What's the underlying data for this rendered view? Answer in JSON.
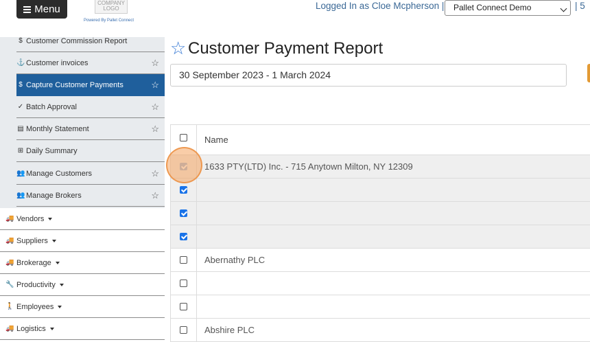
{
  "header": {
    "menu_label": "Menu",
    "logo_text": "COMPANY LOGO",
    "powered_by": "Powered By Pallet Connect",
    "logged_in": "Logged In as Cloe Mcpherson |",
    "company_selected": "Pallet Connect Demo",
    "extra_text": "| 5"
  },
  "sidebar": {
    "sub_items": [
      {
        "icon": "$",
        "label": "Customer Commission Report",
        "star": false,
        "active": false
      },
      {
        "icon": "⚓",
        "label": "Customer invoices",
        "star": true,
        "active": false
      },
      {
        "icon": "$",
        "label": "Capture Customer Payments",
        "star": true,
        "active": true
      },
      {
        "icon": "✓",
        "label": "Batch Approval",
        "star": true,
        "active": false
      },
      {
        "icon": "▤",
        "label": "Monthly Statement",
        "star": true,
        "active": false
      },
      {
        "icon": "⊞",
        "label": "Daily Summary",
        "star": false,
        "active": false
      },
      {
        "icon": "👥",
        "label": "Manage Customers",
        "star": true,
        "active": false
      },
      {
        "icon": "👥",
        "label": "Manage Brokers",
        "star": true,
        "active": false
      }
    ],
    "main_items": [
      {
        "icon": "🚚",
        "label": "Vendors"
      },
      {
        "icon": "🚚",
        "label": "Suppliers"
      },
      {
        "icon": "🚚",
        "label": "Brokerage"
      },
      {
        "icon": "🔧",
        "label": "Productivity"
      },
      {
        "icon": "🚶",
        "label": "Employees"
      },
      {
        "icon": "🚚",
        "label": "Logistics"
      }
    ]
  },
  "main": {
    "title": "Customer Payment Report",
    "date_range": "30 September 2023 - 1 March 2024",
    "table": {
      "header": "Name",
      "rows": [
        {
          "name": "1633 PTY(LTD) Inc. - 715 Anytown Milton, NY 12309",
          "checked": true,
          "dim": true,
          "shade": true
        },
        {
          "name": "",
          "checked": true,
          "dim": false,
          "shade": true
        },
        {
          "name": "",
          "checked": true,
          "dim": false,
          "shade": true
        },
        {
          "name": "",
          "checked": true,
          "dim": false,
          "shade": true
        },
        {
          "name": "Abernathy PLC",
          "checked": false,
          "dim": false,
          "shade": false
        },
        {
          "name": "",
          "checked": false,
          "dim": false,
          "shade": false
        },
        {
          "name": "",
          "checked": false,
          "dim": false,
          "shade": false
        },
        {
          "name": "Abshire PLC",
          "checked": false,
          "dim": false,
          "shade": false
        }
      ]
    }
  },
  "colors": {
    "accent": "#1f5f9c",
    "checkbox": "#1a73e8",
    "highlight": "#f4a460",
    "button_orange": "#e39a34"
  }
}
